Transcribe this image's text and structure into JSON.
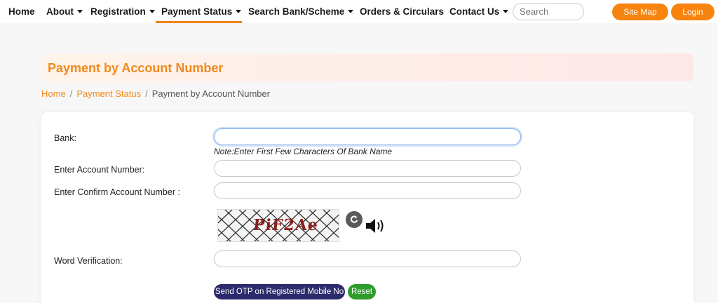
{
  "nav": {
    "items": [
      {
        "label": "Home",
        "dropdown": false
      },
      {
        "label": "About",
        "dropdown": true
      },
      {
        "label": "Registration",
        "dropdown": true
      },
      {
        "label": "Payment Status",
        "dropdown": true,
        "active": true
      },
      {
        "label": "Search Bank/Scheme",
        "dropdown": true
      },
      {
        "label": "Orders & Circulars",
        "dropdown": false
      },
      {
        "label": "Contact Us",
        "dropdown": true
      }
    ],
    "search_placeholder": "Search",
    "site_map_label": "Site Map",
    "login_label": "Login"
  },
  "page": {
    "title": "Payment by Account Number"
  },
  "breadcrumb": {
    "home": "Home",
    "parent": "Payment Status",
    "current": "Payment by Account Number",
    "separator": "/"
  },
  "form": {
    "bank_label": "Bank:",
    "bank_value": "",
    "bank_note": "Note:Enter First Few Characters Of Bank Name",
    "account_label": "Enter Account Number:",
    "account_value": "",
    "confirm_label": "Enter Confirm Account Number :",
    "confirm_value": "",
    "captcha_text": "PiF2Ae",
    "word_verification_label": "Word Verification:",
    "word_verification_value": "",
    "send_otp_label": "Send OTP on Registered Mobile No",
    "reset_label": "Reset"
  },
  "icons": {
    "refresh": "refresh-icon",
    "audio": "speaker-icon",
    "caret": "caret-down-icon"
  },
  "colors": {
    "accent_orange": "#f7840f",
    "title_orange": "#f08a1e",
    "otp_button": "#2c2c6c",
    "reset_button": "#2e9d2e",
    "captcha_text": "#8b2020"
  }
}
